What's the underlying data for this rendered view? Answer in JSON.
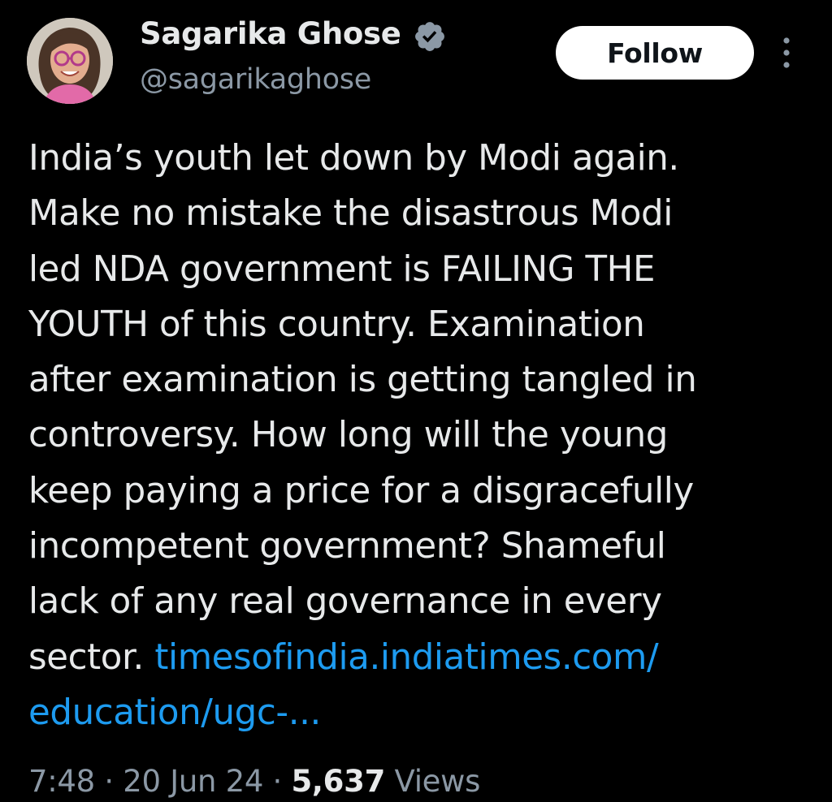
{
  "author": {
    "display_name": "Sagarika Ghose",
    "handle": "@sagarikaghose",
    "verified_icon": "verified-badge-icon",
    "avatar_icon": "profile-photo"
  },
  "actions": {
    "follow_label": "Follow",
    "more_icon": "more-vertical-icon"
  },
  "tweet": {
    "text": "India’s youth let down by Modi again.\nMake no mistake the disastrous Modi\nled NDA government is FAILING THE\nYOUTH of this country. Examination\nafter examination is getting tangled in\ncontroversy. How long will the young\nkeep paying a price for a disgracefully\nincompetent government? Shameful\nlack of any real governance in every\nsector. ",
    "link": "timesofindia.indiatimes.com/\neducation/ugc-..."
  },
  "meta": {
    "time": "7:48",
    "separator": " · ",
    "date": "20 Jun 24",
    "views_count": "5,637",
    "views_label": " Views"
  },
  "colors": {
    "background": "#000000",
    "text": "#e7e9ea",
    "secondary_text": "#8b98a5",
    "link": "#1d9bf0",
    "follow_bg": "#ffffff"
  }
}
